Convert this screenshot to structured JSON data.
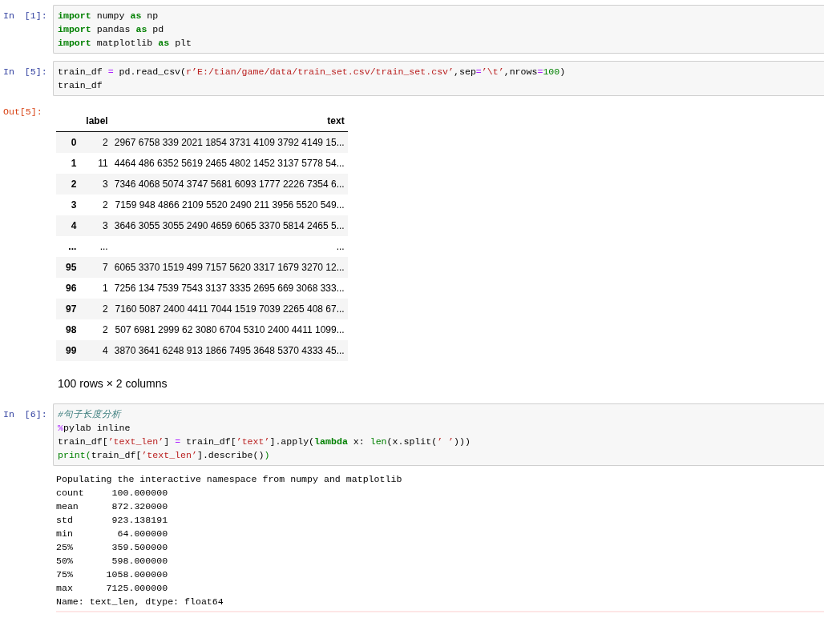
{
  "cells": [
    {
      "prompt": "In [1]:",
      "lines": [
        [
          {
            "kind": "keyword",
            "t": "import"
          },
          {
            "kind": "plain",
            "t": " numpy "
          },
          {
            "kind": "keyword",
            "t": "as"
          },
          {
            "kind": "plain",
            "t": " np"
          }
        ],
        [
          {
            "kind": "keyword",
            "t": "import"
          },
          {
            "kind": "plain",
            "t": " pandas "
          },
          {
            "kind": "keyword",
            "t": "as"
          },
          {
            "kind": "plain",
            "t": " pd"
          }
        ],
        [
          {
            "kind": "keyword",
            "t": "import"
          },
          {
            "kind": "plain",
            "t": " matplotlib "
          },
          {
            "kind": "keyword",
            "t": "as"
          },
          {
            "kind": "plain",
            "t": " plt"
          }
        ]
      ]
    },
    {
      "prompt": "In [5]:",
      "lines": [
        [
          {
            "kind": "plain",
            "t": "train_df "
          },
          {
            "kind": "operator",
            "t": "="
          },
          {
            "kind": "plain",
            "t": " pd.read_csv("
          },
          {
            "kind": "string",
            "t": "r’E:/tian/game/data/train_set.csv/train_set.csv’"
          },
          {
            "kind": "plain",
            "t": ",sep"
          },
          {
            "kind": "operator",
            "t": "="
          },
          {
            "kind": "string",
            "t": "’\\t’"
          },
          {
            "kind": "plain",
            "t": ",nrows"
          },
          {
            "kind": "operator",
            "t": "="
          },
          {
            "kind": "number",
            "t": "100"
          },
          {
            "kind": "plain",
            "t": ")"
          }
        ],
        [
          {
            "kind": "plain",
            "t": "train_df"
          }
        ]
      ],
      "outputs": [
        {
          "kind": "dataframe",
          "prompt": "Out[5]:",
          "columns": [
            "label",
            "text"
          ],
          "rows": [
            {
              "index": "0",
              "label": "2",
              "text": "2967 6758 339 2021 1854 3731 4109 3792 4149 15..."
            },
            {
              "index": "1",
              "label": "11",
              "text": "4464 486 6352 5619 2465 4802 1452 3137 5778 54..."
            },
            {
              "index": "2",
              "label": "3",
              "text": "7346 4068 5074 3747 5681 6093 1777 2226 7354 6..."
            },
            {
              "index": "3",
              "label": "2",
              "text": "7159 948 4866 2109 5520 2490 211 3956 5520 549..."
            },
            {
              "index": "4",
              "label": "3",
              "text": "3646 3055 3055 2490 4659 6065 3370 5814 2465 5..."
            },
            {
              "index": "...",
              "label": "...",
              "text": "..."
            },
            {
              "index": "95",
              "label": "7",
              "text": "6065 3370 1519 499 7157 5620 3317 1679 3270 12..."
            },
            {
              "index": "96",
              "label": "1",
              "text": "7256 134 7539 7543 3137 3335 2695 669 3068 333..."
            },
            {
              "index": "97",
              "label": "2",
              "text": "7160 5087 2400 4411 7044 1519 7039 2265 408 67..."
            },
            {
              "index": "98",
              "label": "2",
              "text": "507 6981 2999 62 3080 6704 5310 2400 4411 1099..."
            },
            {
              "index": "99",
              "label": "4",
              "text": "3870 3641 6248 913 1866 7495 3648 5370 4333 45..."
            }
          ],
          "shape": "100 rows × 2 columns"
        }
      ]
    },
    {
      "prompt": "In [6]:",
      "lines": [
        [
          {
            "kind": "comment",
            "t": "#句子长度分析"
          }
        ],
        [
          {
            "kind": "operator",
            "t": "%"
          },
          {
            "kind": "plain",
            "t": "pylab inline"
          }
        ],
        [
          {
            "kind": "plain",
            "t": "train_df["
          },
          {
            "kind": "string",
            "t": "’text_len’"
          },
          {
            "kind": "plain",
            "t": "] "
          },
          {
            "kind": "operator",
            "t": "="
          },
          {
            "kind": "plain",
            "t": " train_df["
          },
          {
            "kind": "string",
            "t": "’text’"
          },
          {
            "kind": "plain",
            "t": "].apply("
          },
          {
            "kind": "keyword",
            "t": "lambda"
          },
          {
            "kind": "plain",
            "t": " x: "
          },
          {
            "kind": "builtin",
            "t": "len"
          },
          {
            "kind": "plain",
            "t": "(x.split("
          },
          {
            "kind": "string",
            "t": "’ ’"
          },
          {
            "kind": "plain",
            "t": ")))"
          }
        ],
        [
          {
            "kind": "builtin",
            "t": "print("
          },
          {
            "kind": "plain",
            "t": "train_df["
          },
          {
            "kind": "string",
            "t": "’text_len’"
          },
          {
            "kind": "plain",
            "t": "].describe()"
          },
          {
            "kind": "builtin",
            "t": ")"
          }
        ]
      ],
      "outputs": [
        {
          "kind": "stream",
          "lines": [
            "Populating the interactive namespace from numpy and matplotlib",
            "count     100.000000",
            "mean      872.320000",
            "std       923.138191",
            "min        64.000000",
            "25%       359.500000",
            "50%       598.000000",
            "75%      1058.000000",
            "max      7125.000000",
            "Name: text_len, dtype: float64"
          ]
        }
      ]
    }
  ]
}
